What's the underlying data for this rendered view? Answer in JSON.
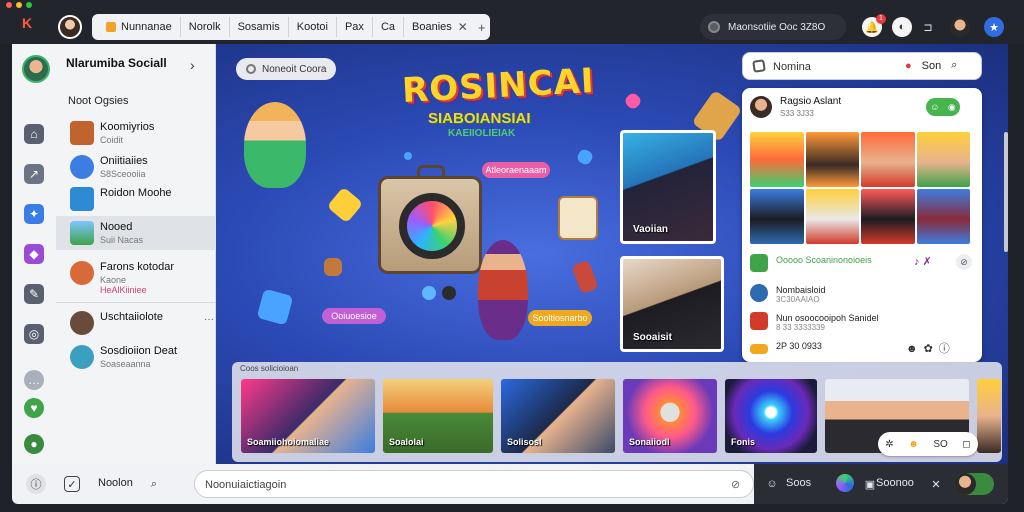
{
  "window": {
    "dots": [
      "#ff5f57",
      "#febc2e",
      "#28c840"
    ],
    "accent": "#ff5a3c"
  },
  "header": {
    "tabs": [
      {
        "label": "Nunnanae"
      },
      {
        "label": "Norolk"
      },
      {
        "label": "Sosamis"
      },
      {
        "label": "Kootoi"
      },
      {
        "label": "Pax"
      },
      {
        "label": "Ca"
      },
      {
        "label": "Boanies"
      }
    ],
    "status_text": "Maonsotiie Ooc 3Z8O",
    "notification_count": "1",
    "icons": [
      "notifications-icon",
      "dnd-icon",
      "profile-menu-icon",
      "star-icon"
    ]
  },
  "sidebar": {
    "profile_name": "Nlarumiba Sociall",
    "section_title": "Noot Ogsies",
    "items": [
      {
        "name": "Koomiyrios",
        "sub": "Coidit",
        "color": "#c0632c"
      },
      {
        "name": "Oniitiaiies",
        "sub": "S8Sceooiia",
        "color": "#3b7de0"
      },
      {
        "name": "Roidon Moohe",
        "sub": "",
        "color": "#2d8bd4"
      },
      {
        "name": "Nooed",
        "sub": "Suii Nacas",
        "color": "#3fa34a"
      },
      {
        "name": "Farons kotodar",
        "sub": "Kaone",
        "tag": "HeAlKiiniee",
        "color": "#d86a3a"
      },
      {
        "name": "Uschtaiiolote",
        "sub": "",
        "color": "#6a4a3a"
      },
      {
        "name": "Sosdioiion Deat",
        "sub": "Soaseaanna",
        "color": "#3aa0c0"
      }
    ],
    "rail_icons": [
      "home-icon",
      "share-icon",
      "people-icon",
      "gift-icon",
      "pen-icon",
      "camera-icon",
      "chat-icon",
      "heart-icon",
      "location-icon"
    ]
  },
  "main": {
    "pill_label": "Noneoit Coora",
    "hero_title": "ROSINCAI",
    "hero_subtitle": "SIABOIANSIAI",
    "hero_tag": "KAEIIOLIEIAK",
    "label_1": "Atleoraenaaam",
    "label_2": "Ooiuoesioe",
    "label_3": "Sooltiosnarbo",
    "video_caption_1": "Vaoiian",
    "video_caption_2": "Sooaisit"
  },
  "panel": {
    "search_placeholder": "Nomina",
    "search_right_label": "Son",
    "title": "Ragsio Aslant",
    "subtitle": "S33 3J33",
    "rows": [
      {
        "text": "Ooooo Scoaninonoioeis",
        "sub": "",
        "color": "#3fa34a"
      },
      {
        "text": "Nombaisloid",
        "sub": "3C30AAIAO",
        "color": "#2d6bb0"
      },
      {
        "text": "Nun osoocooipoh Sanidel",
        "sub": "8 33 3333339",
        "color": "#d23a2a"
      },
      {
        "text": "2P 30 0933",
        "sub": "",
        "color": "#f0a81f"
      }
    ]
  },
  "strip": {
    "title": "Coos solicioioan",
    "cards": [
      {
        "caption": "Soamiiohoiomaliae"
      },
      {
        "caption": "Soalolai"
      },
      {
        "caption": "Solisosl"
      },
      {
        "caption": "Sonaiiodl"
      },
      {
        "caption": "Fonis"
      },
      {
        "caption": ""
      }
    ],
    "react_count": "SO"
  },
  "bottom": {
    "label": "Noolon",
    "compose_placeholder": "Noonuiaictiagoin",
    "right_label_1": "Soos",
    "right_label_2": "Soonoo"
  }
}
